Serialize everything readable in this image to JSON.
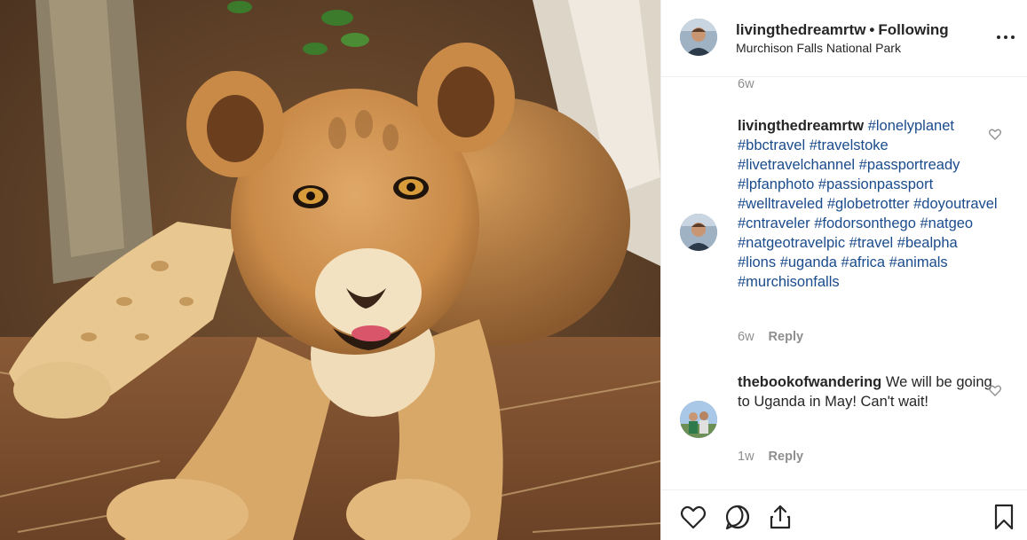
{
  "header": {
    "username": "livingthedreamrtw",
    "separator": "•",
    "follow_status": "Following",
    "location": "Murchison Falls National Park"
  },
  "comments": {
    "prev_time": "6w",
    "caption": {
      "username": "livingthedreamrtw",
      "hashtags": "#lonelyplanet #bbctravel #travelstoke #livetravelchannel #passportready #lpfanphoto #passionpassport #welltraveled #globetrotter #doyoutravel #cntraveler #fodorsonthego #natgeo #natgeotravelpic #travel #bealpha #lions #uganda #africa #animals #murchisonfalls",
      "time": "6w",
      "reply_label": "Reply"
    },
    "reply": {
      "username": "thebookofwandering",
      "text": "We will be going to Uganda in May! Can't wait!",
      "time": "1w",
      "reply_label": "Reply"
    }
  },
  "icons": {
    "like": "heart-icon",
    "comment": "comment-icon",
    "share": "share-icon",
    "save": "bookmark-icon",
    "more": "more-icon"
  },
  "colors": {
    "hashtag": "#1a4b8c",
    "secondary_text": "#8e8e8e",
    "primary_text": "#262626",
    "divider": "#efefef"
  }
}
